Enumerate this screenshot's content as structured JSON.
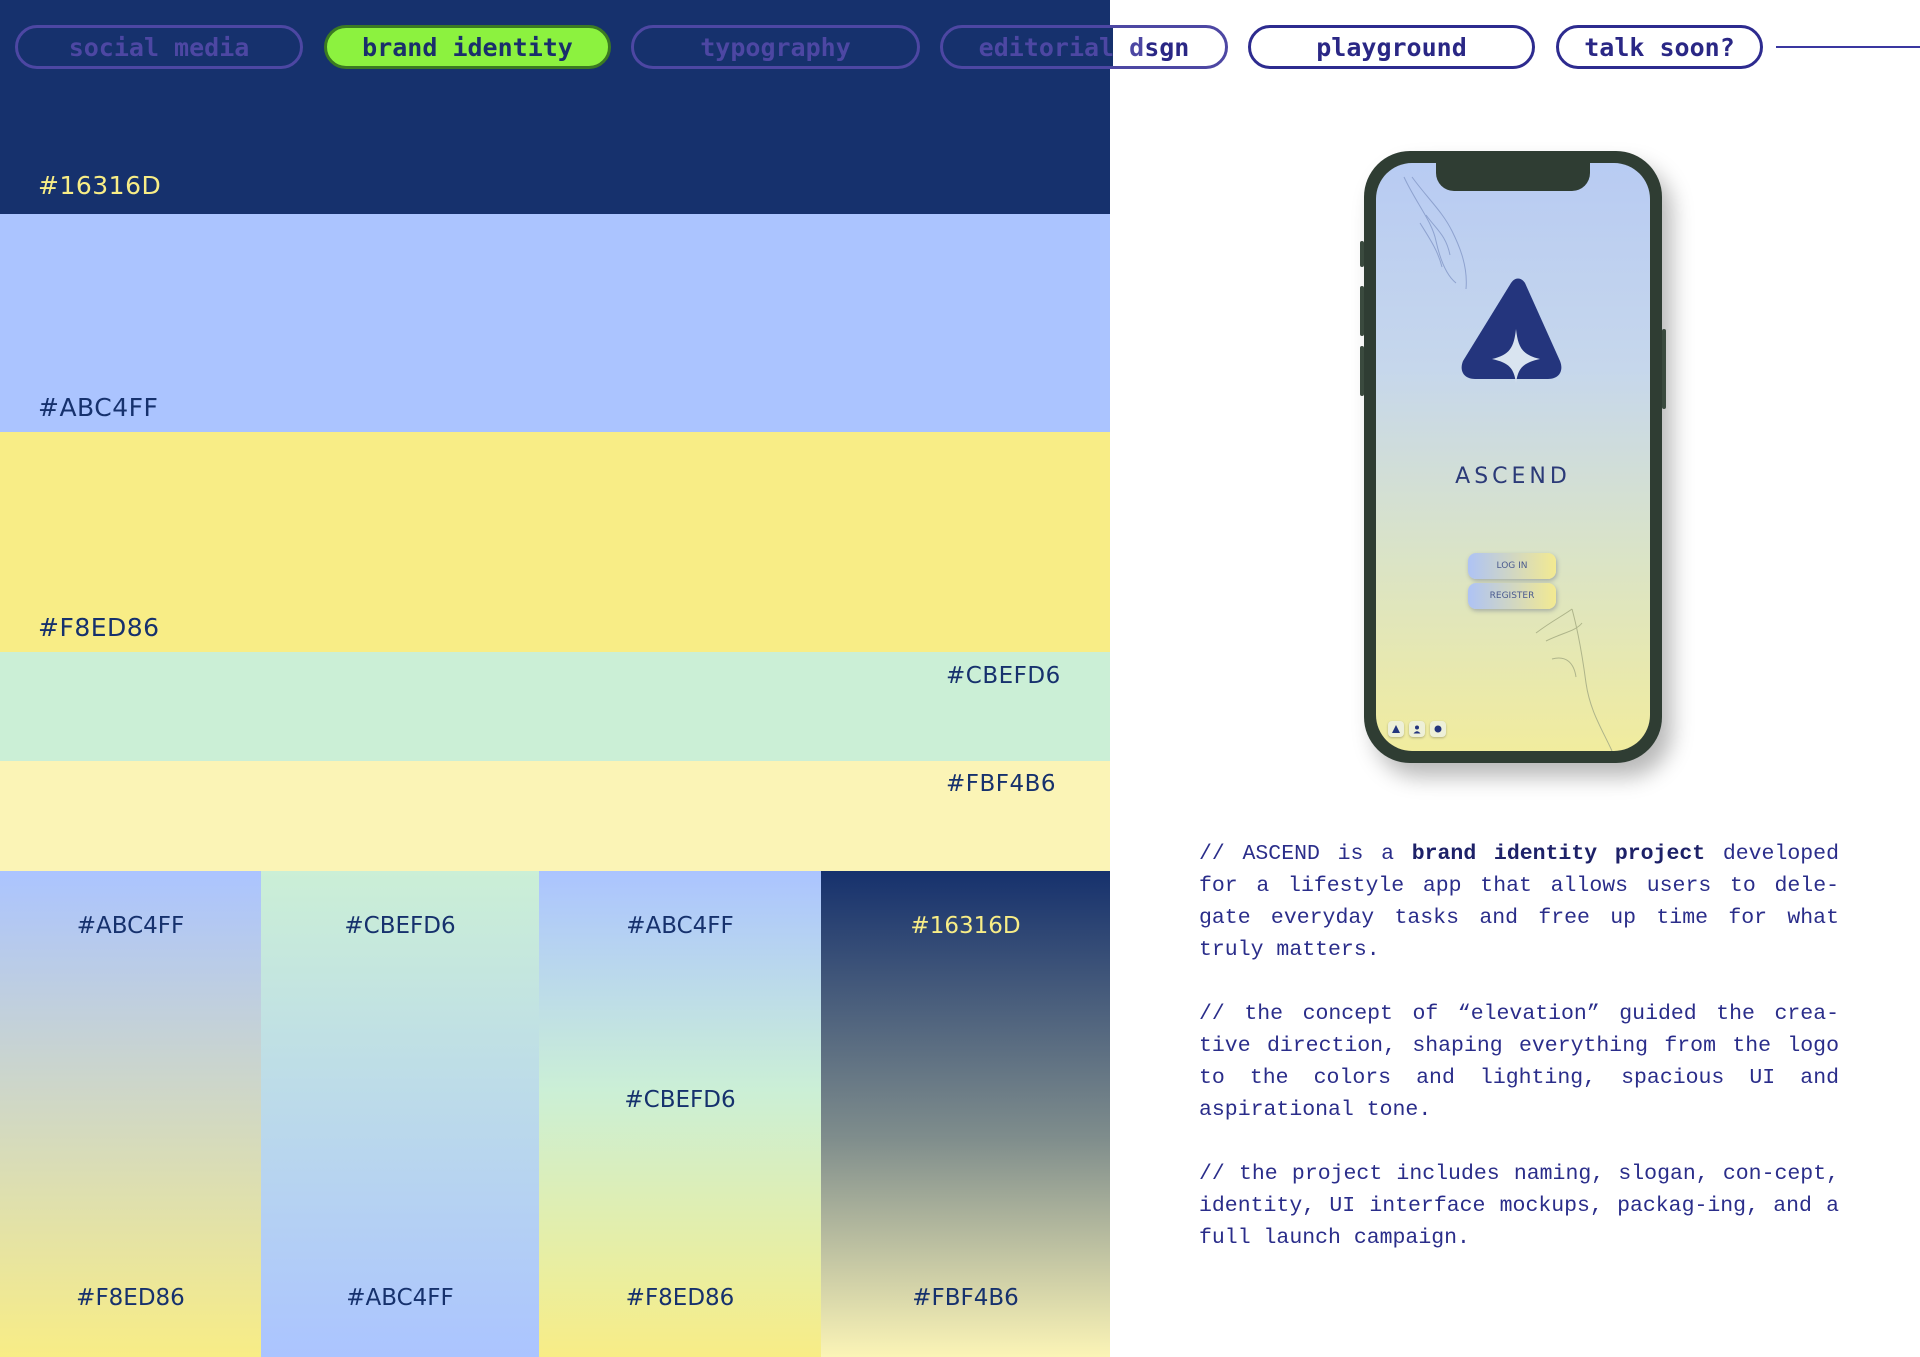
{
  "nav": {
    "items": [
      {
        "label": "social media"
      },
      {
        "label": "brand identity"
      },
      {
        "label": "typography"
      },
      {
        "label": "editorial dsgn"
      },
      {
        "label": "playground"
      },
      {
        "label": "talk soon?"
      }
    ],
    "active_index": 1
  },
  "palette": {
    "bands": [
      {
        "hex": "#16316D",
        "color": "#16316D",
        "text_color": "#F8ED86"
      },
      {
        "hex": "#ABC4FF",
        "color": "#ABC4FF",
        "text_color": "#16316D"
      },
      {
        "hex": "#F8ED86",
        "color": "#F8ED86",
        "text_color": "#16316D"
      },
      {
        "hex": "#CBEFD6",
        "color": "#CBEFD6",
        "text_color": "#16316D"
      },
      {
        "hex": "#FBF4B6",
        "color": "#FBF4B6",
        "text_color": "#16316D"
      }
    ],
    "gradients": [
      {
        "labels": [
          "#ABC4FF",
          "#F8ED86"
        ],
        "colors": [
          "#ABC4FF",
          "#F8ED86"
        ]
      },
      {
        "labels": [
          "#CBEFD6",
          "#ABC4FF"
        ],
        "colors": [
          "#CBEFD6",
          "#ABC4FF"
        ]
      },
      {
        "labels": [
          "#ABC4FF",
          "#CBEFD6",
          "#F8ED86"
        ],
        "colors": [
          "#ABC4FF",
          "#CBEFD6",
          "#F8ED86"
        ]
      },
      {
        "labels": [
          "#16316D",
          "#FBF4B6"
        ],
        "colors": [
          "#16316D",
          "#FBF4B6"
        ]
      }
    ]
  },
  "phone": {
    "app_name": "ASCEND",
    "login_label": "LOG IN",
    "register_label": "REGISTER",
    "tab_icons": [
      "triangle-icon",
      "person-icon",
      "dot-icon"
    ]
  },
  "description": {
    "p1_before": "// ASCEND is a ",
    "p1_bold": "brand identity project",
    "p1_after": " developed for a lifestyle app that allows users to dele-gate everyday tasks and free up time for what truly matters.",
    "p2": "// the concept of “elevation” guided the crea-tive direction, shaping everything from the logo to the colors and lighting, spacious UI and aspirational tone.",
    "p3": "// the project includes naming, slogan, con-cept, identity, UI interface mockups, packag-ing, and a full launch campaign."
  }
}
